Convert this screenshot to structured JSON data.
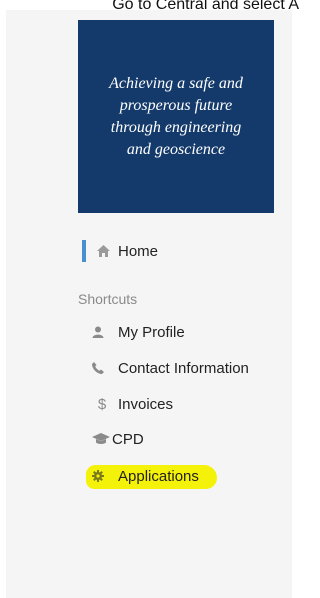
{
  "caption": "Go to Central and select A",
  "banner": {
    "text": "Achieving a safe and\nprosperous future\nthrough engineering\nand geoscience"
  },
  "nav": {
    "home": {
      "label": "Home",
      "icon": "home-icon"
    }
  },
  "shortcuts": {
    "title": "Shortcuts",
    "items": [
      {
        "label": "My Profile",
        "icon": "user-icon"
      },
      {
        "label": "Contact Information",
        "icon": "phone-icon"
      },
      {
        "label": "Invoices",
        "icon": "dollar-icon"
      },
      {
        "label": "CPD",
        "icon": "graduation-cap-icon"
      },
      {
        "label": "Applications",
        "icon": "gear-icon",
        "highlighted": true
      }
    ]
  },
  "colors": {
    "banner_bg": "#143a6b",
    "home_accent": "#4a8fd0",
    "highlight": "#f5f20a"
  }
}
